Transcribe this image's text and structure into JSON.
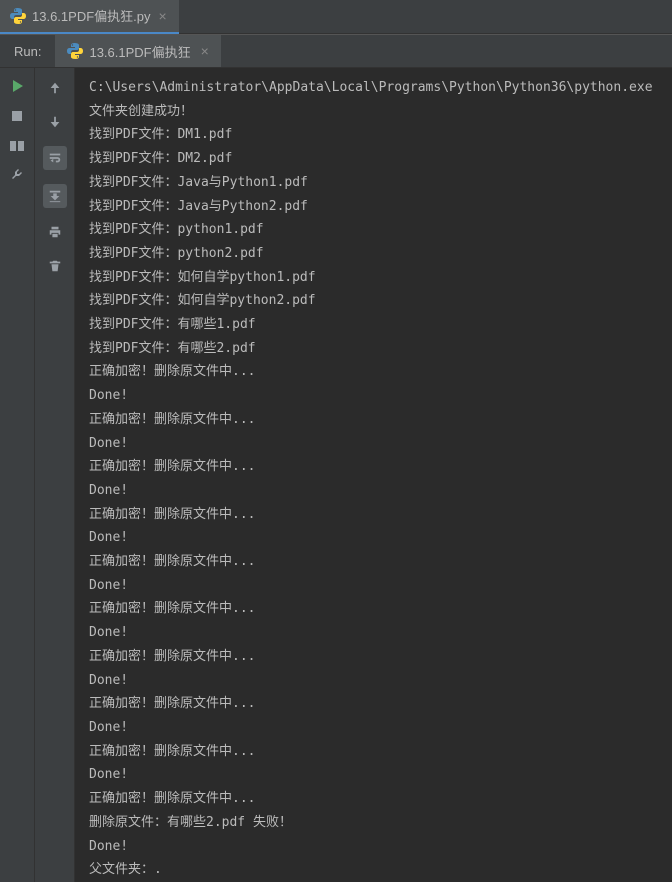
{
  "file_tab": {
    "label": "13.6.1PDF偏执狂.py"
  },
  "run": {
    "label": "Run:",
    "tab_label": "13.6.1PDF偏执狂"
  },
  "console_lines": [
    "C:\\Users\\Administrator\\AppData\\Local\\Programs\\Python\\Python36\\python.exe",
    "文件夹创建成功！",
    "找到PDF文件：DM1.pdf",
    "找到PDF文件：DM2.pdf",
    "找到PDF文件：Java与Python1.pdf",
    "找到PDF文件：Java与Python2.pdf",
    "找到PDF文件：python1.pdf",
    "找到PDF文件：python2.pdf",
    "找到PDF文件：如何自学python1.pdf",
    "找到PDF文件：如何自学python2.pdf",
    "找到PDF文件：有哪些1.pdf",
    "找到PDF文件：有哪些2.pdf",
    "正确加密！删除原文件中...",
    "Done!",
    "正确加密！删除原文件中...",
    "Done!",
    "正确加密！删除原文件中...",
    "Done!",
    "正确加密！删除原文件中...",
    "Done!",
    "正确加密！删除原文件中...",
    "Done!",
    "正确加密！删除原文件中...",
    "Done!",
    "正确加密！删除原文件中...",
    "Done!",
    "正确加密！删除原文件中...",
    "Done!",
    "正确加密！删除原文件中...",
    "Done!",
    "正确加密！删除原文件中...",
    "删除原文件：有哪些2.pdf 失败！",
    "Done!",
    "父文件夹：."
  ]
}
